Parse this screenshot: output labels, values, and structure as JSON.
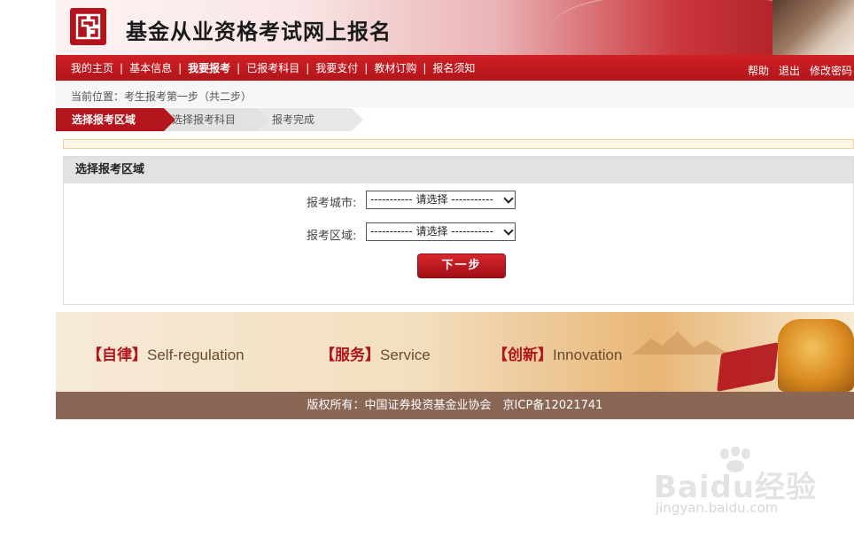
{
  "header": {
    "title": "基金从业资格考试网上报名"
  },
  "nav": {
    "items": [
      {
        "label": "我的主页",
        "active": false
      },
      {
        "label": "基本信息",
        "active": false
      },
      {
        "label": "我要报考",
        "active": true
      },
      {
        "label": "已报考科目",
        "active": false
      },
      {
        "label": "我要支付",
        "active": false
      },
      {
        "label": "教材订购",
        "active": false
      },
      {
        "label": "报名须知",
        "active": false
      }
    ],
    "right_items": [
      {
        "label": "帮助"
      },
      {
        "label": "退出"
      },
      {
        "label": "修改密码"
      }
    ]
  },
  "breadcrumb": {
    "text": "当前位置：考生报考第一步（共二步）"
  },
  "steps": [
    {
      "label": "选择报考区域",
      "state": "current"
    },
    {
      "label": "选择报考科目",
      "state": "pending"
    },
    {
      "label": "报考完成",
      "state": "pending"
    }
  ],
  "form": {
    "title": "选择报考区域",
    "city_label": "报考城市:",
    "city_value": "----------- 请选择 -----------",
    "area_label": "报考区域:",
    "area_value": "----------- 请选择 -----------",
    "next_label": "下一步"
  },
  "banner": {
    "items": [
      {
        "zh": "自律",
        "en": "Self-regulation"
      },
      {
        "zh": "服务",
        "en": "Service"
      },
      {
        "zh": "创新",
        "en": "Innovation"
      }
    ]
  },
  "footer": {
    "copyright": "版权所有：中国证券投资基金业协会　京ICP备12021741"
  },
  "watermark": {
    "brand": "Baidu经验",
    "url": "jingyan.baidu.com"
  },
  "colors": {
    "brand_red": "#b5151c",
    "footer_brown": "#8a6655"
  }
}
